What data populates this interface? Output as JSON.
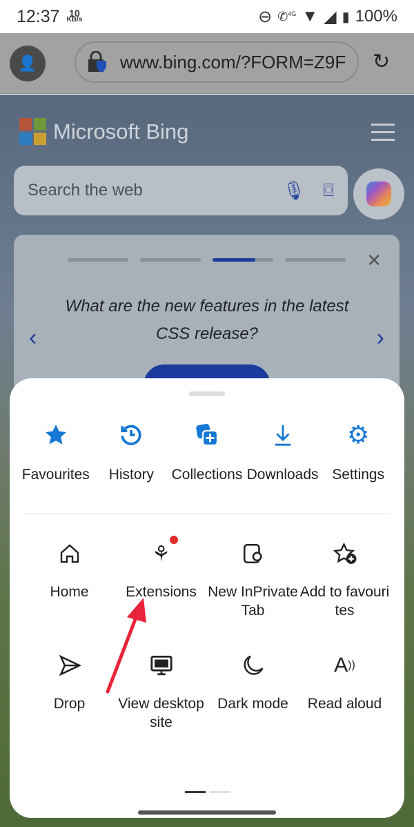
{
  "status_bar": {
    "time": "12:37",
    "speed_value": "10",
    "speed_unit": "KB/s",
    "network": "4G",
    "battery": "100%"
  },
  "browser": {
    "url": "www.bing.com/?FORM=Z9F"
  },
  "bing": {
    "logo_text": "Microsoft Bing",
    "search_placeholder": "Search the web",
    "carousel_question": "What are the new features in the latest CSS release?",
    "carousel_active_index": 3,
    "carousel_count": 4
  },
  "menu": {
    "top_row": [
      {
        "label": "Favourites",
        "icon": "star-icon"
      },
      {
        "label": "History",
        "icon": "history-icon"
      },
      {
        "label": "Collections",
        "icon": "collections-icon"
      },
      {
        "label": "Downloads",
        "icon": "download-icon"
      },
      {
        "label": "Settings",
        "icon": "gear-icon"
      }
    ],
    "grid": [
      {
        "label": "Home",
        "icon": "home-icon"
      },
      {
        "label": "Extensions",
        "icon": "puzzle-icon",
        "badge": true
      },
      {
        "label": "New InPrivate Tab",
        "icon": "inprivate-icon"
      },
      {
        "label": "Add to favourites",
        "icon": "star-add-icon"
      },
      {
        "label": "Drop",
        "icon": "send-icon"
      },
      {
        "label": "View desktop site",
        "icon": "desktop-icon"
      },
      {
        "label": "Dark mode",
        "icon": "moon-icon"
      },
      {
        "label": "Read aloud",
        "icon": "read-aloud-icon"
      }
    ],
    "page_index": 1,
    "page_count": 2
  },
  "colors": {
    "accent": "#1478d4",
    "badge": "#e02b2b",
    "annotation_arrow": "#e8243a"
  }
}
